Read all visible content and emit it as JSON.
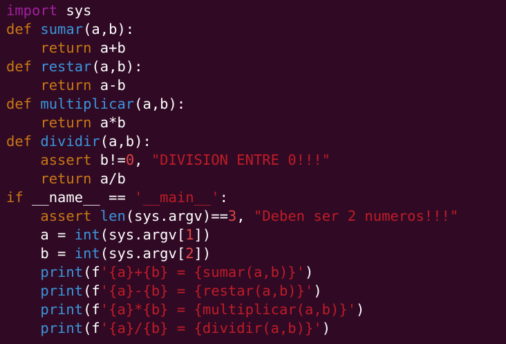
{
  "editor": {
    "background": "#300a24",
    "colors": {
      "keyword_import": "#a020a0",
      "keyword": "#c87814",
      "function": "#3a96dd",
      "number": "#e04545",
      "string": "#c01c28",
      "text": "#ffffff"
    },
    "lines": [
      [
        {
          "t": "import",
          "c": "kw-import"
        },
        {
          "t": " sys",
          "c": "plain"
        }
      ],
      [
        {
          "t": "def",
          "c": "kw"
        },
        {
          "t": " ",
          "c": "plain"
        },
        {
          "t": "sumar",
          "c": "fn"
        },
        {
          "t": "(a,b):",
          "c": "plain"
        }
      ],
      [
        {
          "t": "    ",
          "c": "plain"
        },
        {
          "t": "return",
          "c": "kw"
        },
        {
          "t": " a+b",
          "c": "plain"
        }
      ],
      [
        {
          "t": "def",
          "c": "kw"
        },
        {
          "t": " ",
          "c": "plain"
        },
        {
          "t": "restar",
          "c": "fn"
        },
        {
          "t": "(a,b):",
          "c": "plain"
        }
      ],
      [
        {
          "t": "    ",
          "c": "plain"
        },
        {
          "t": "return",
          "c": "kw"
        },
        {
          "t": " a-b",
          "c": "plain"
        }
      ],
      [
        {
          "t": "def",
          "c": "kw"
        },
        {
          "t": " ",
          "c": "plain"
        },
        {
          "t": "multiplicar",
          "c": "fn"
        },
        {
          "t": "(a,b):",
          "c": "plain"
        }
      ],
      [
        {
          "t": "    ",
          "c": "plain"
        },
        {
          "t": "return",
          "c": "kw"
        },
        {
          "t": " a*b",
          "c": "plain"
        }
      ],
      [
        {
          "t": "def",
          "c": "kw"
        },
        {
          "t": " ",
          "c": "plain"
        },
        {
          "t": "dividir",
          "c": "fn"
        },
        {
          "t": "(a,b):",
          "c": "plain"
        }
      ],
      [
        {
          "t": "    ",
          "c": "plain"
        },
        {
          "t": "assert",
          "c": "kw"
        },
        {
          "t": " b!=",
          "c": "plain"
        },
        {
          "t": "0",
          "c": "num"
        },
        {
          "t": ", ",
          "c": "plain"
        },
        {
          "t": "\"DIVISION ENTRE 0!!!\"",
          "c": "str"
        }
      ],
      [
        {
          "t": "    ",
          "c": "plain"
        },
        {
          "t": "return",
          "c": "kw"
        },
        {
          "t": " a/b",
          "c": "plain"
        }
      ],
      [
        {
          "t": "if",
          "c": "kw"
        },
        {
          "t": " __name__ == ",
          "c": "plain"
        },
        {
          "t": "'__main__'",
          "c": "str"
        },
        {
          "t": ":",
          "c": "plain"
        }
      ],
      [
        {
          "t": "    ",
          "c": "plain"
        },
        {
          "t": "assert",
          "c": "kw"
        },
        {
          "t": " ",
          "c": "plain"
        },
        {
          "t": "len",
          "c": "fn"
        },
        {
          "t": "(sys.argv)==",
          "c": "plain"
        },
        {
          "t": "3",
          "c": "num"
        },
        {
          "t": ", ",
          "c": "plain"
        },
        {
          "t": "\"Deben ser 2 numeros!!!\"",
          "c": "str"
        }
      ],
      [
        {
          "t": "    a = ",
          "c": "plain"
        },
        {
          "t": "int",
          "c": "fn"
        },
        {
          "t": "(sys.argv[",
          "c": "plain"
        },
        {
          "t": "1",
          "c": "num"
        },
        {
          "t": "])",
          "c": "plain"
        }
      ],
      [
        {
          "t": "    b = ",
          "c": "plain"
        },
        {
          "t": "int",
          "c": "fn"
        },
        {
          "t": "(sys.argv[",
          "c": "plain"
        },
        {
          "t": "2",
          "c": "num"
        },
        {
          "t": "])",
          "c": "plain"
        }
      ],
      [
        {
          "t": "    ",
          "c": "plain"
        },
        {
          "t": "print",
          "c": "fn"
        },
        {
          "t": "(f",
          "c": "plain"
        },
        {
          "t": "'{a}+{b} = {sumar(a,b)}'",
          "c": "str"
        },
        {
          "t": ")",
          "c": "plain"
        }
      ],
      [
        {
          "t": "    ",
          "c": "plain"
        },
        {
          "t": "print",
          "c": "fn"
        },
        {
          "t": "(f",
          "c": "plain"
        },
        {
          "t": "'{a}-{b} = {restar(a,b)}'",
          "c": "str"
        },
        {
          "t": ")",
          "c": "plain"
        }
      ],
      [
        {
          "t": "    ",
          "c": "plain"
        },
        {
          "t": "print",
          "c": "fn"
        },
        {
          "t": "(f",
          "c": "plain"
        },
        {
          "t": "'{a}*{b} = {multiplicar(a,b)}'",
          "c": "str"
        },
        {
          "t": ")",
          "c": "plain"
        }
      ],
      [
        {
          "t": "    ",
          "c": "plain"
        },
        {
          "t": "print",
          "c": "fn"
        },
        {
          "t": "(f",
          "c": "plain"
        },
        {
          "t": "'{a}/{b} = {dividir(a,b)}'",
          "c": "str"
        },
        {
          "t": ")",
          "c": "plain"
        }
      ]
    ]
  }
}
